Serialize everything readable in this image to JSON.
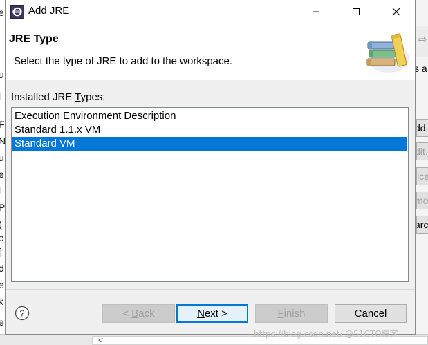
{
  "window": {
    "title": "Add JRE",
    "minimize_icon": "minimize-icon",
    "maximize_icon": "maximize-icon",
    "close_icon": "close-icon"
  },
  "header": {
    "title": "JRE Type",
    "description": "Select the type of JRE to add to the workspace.",
    "graphic_icon": "books-wizard-graphic"
  },
  "list_label": {
    "before": "Installed JRE ",
    "mnemonic": "T",
    "after": "ypes:"
  },
  "jre_types": [
    {
      "label": "Execution Environment Description",
      "selected": false
    },
    {
      "label": "Standard 1.1.x VM",
      "selected": false
    },
    {
      "label": "Standard VM",
      "selected": true
    }
  ],
  "buttons": {
    "back": {
      "prefix": "< ",
      "mnemonic": "B",
      "rest": "ack",
      "enabled": false
    },
    "next": {
      "mnemonic": "N",
      "rest": "ext >",
      "enabled": true
    },
    "finish": {
      "mnemonic": "F",
      "rest": "inish",
      "enabled": false
    },
    "cancel": {
      "label": "Cancel",
      "enabled": true
    }
  },
  "help_icon": "help-icon",
  "background": {
    "left_fragments": [
      "e",
      "u",
      "l",
      "F",
      "N",
      "u",
      "e",
      "l",
      "P",
      "(",
      "c",
      "[",
      "d",
      "e",
      "k",
      "e"
    ],
    "right_fragments": [
      "s a",
      "dd.",
      "dit.",
      "lica",
      "mo",
      "arch"
    ]
  },
  "watermark": "https://blog.csdn.net/ @51CTO博客",
  "colors": {
    "selection": "#0078d7",
    "default_button_border": "#0078d7",
    "dialog_bg": "#f0f0f0"
  }
}
